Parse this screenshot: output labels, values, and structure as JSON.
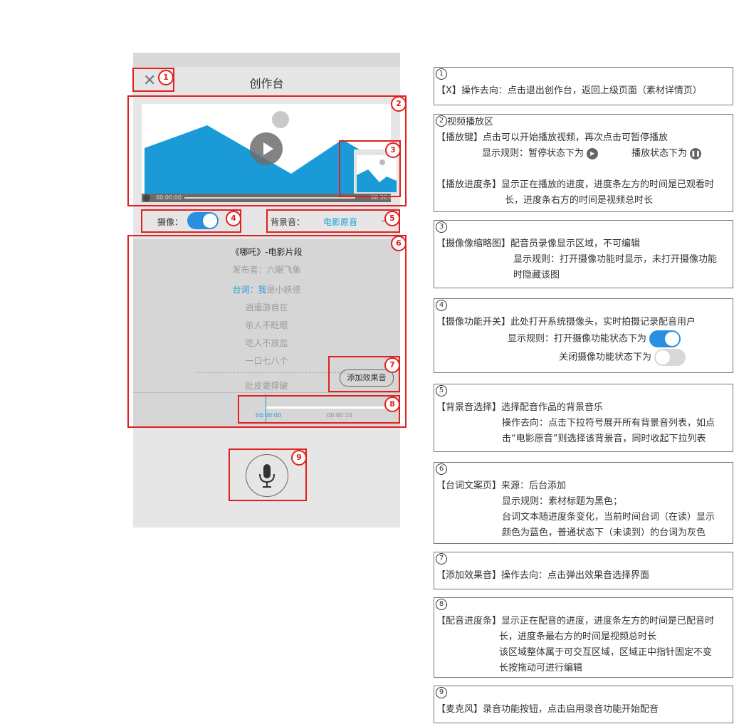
{
  "phone": {
    "title": "创作台",
    "close_glyph": "✕",
    "video": {
      "time_start": "00:00:00",
      "time_end": "00:30:00"
    },
    "camera_label": "摄像：",
    "camera_on": true,
    "bgm_label": "背景音：",
    "bgm_value": "电影原音",
    "material_title": "《哪吒》-电影片段",
    "publisher": "发布者：六眼飞鱼",
    "lyric_prefix": "台词：",
    "lyric_current_read": "我",
    "lyric_current_rest": "是小妖怪",
    "lyrics": [
      "逍遥游自在",
      "杀人不眨眼",
      "吃人不放盐",
      "一口七八个",
      "肚皮要撑破"
    ],
    "add_effect_label": "添加效果音",
    "dub_time_start": "00:00:00",
    "dub_time_end": "00:00:10",
    "mic_icon": "microphone-icon"
  },
  "badges": [
    "1",
    "2",
    "3",
    "4",
    "5",
    "6",
    "7",
    "8",
    "9"
  ],
  "colors": {
    "accent": "#1a9bd7",
    "annotation": "#e02020",
    "toggle_on": "#2a8fe0"
  },
  "notes": [
    {
      "num": "1",
      "lines": [
        "【X】操作去向：点击退出创作台，返回上级页面（素材详情页）"
      ]
    },
    {
      "num": "2",
      "heading": "视频播放区",
      "lines": [
        "【播放键】点击可以开始播放视频，再次点击可暂停播放",
        "显示规则：暂停状态下为",
        "播放状态下为",
        "【播放进度条】显示正在播放的进度，进度条左方的时间是已观看时",
        "长，进度条右方的时间是视频总时长"
      ]
    },
    {
      "num": "3",
      "lines": [
        "【摄像像缩略图】配音员录像显示区域，不可编辑",
        "显示规则：打开摄像功能时显示，未打开摄像功能",
        "时隐藏该图"
      ]
    },
    {
      "num": "4",
      "lines": [
        "【摄像功能开关】此处打开系统摄像头，实时拍摄记录配音用户",
        "显示规则：打开摄像功能状态下为",
        "关闭摄像功能状态下为"
      ]
    },
    {
      "num": "5",
      "lines": [
        "【背景音选择】选择配音作品的背景音乐",
        "操作去向：点击下拉符号展开所有背景音列表，如点",
        "击“电影原音”则选择该背景音，同时收起下拉列表"
      ]
    },
    {
      "num": "6",
      "lines": [
        "【台词文案页】来源：后台添加",
        "显示规则：素材标题为黑色；",
        "台词文本随进度条变化，当前时间台词（在读）显示",
        "颜色为蓝色，普通状态下（未读到）的台词为灰色"
      ]
    },
    {
      "num": "7",
      "lines": [
        "【添加效果音】操作去向：点击弹出效果音选择界面"
      ]
    },
    {
      "num": "8",
      "lines": [
        "【配音进度条】显示正在配音的进度，进度条左方的时间是已配音时",
        "长，进度条最右方的时间是视频总时长",
        "该区域整体属于可交互区域，区域正中指针固定不变",
        "长按拖动可进行编辑"
      ]
    },
    {
      "num": "9",
      "lines": [
        "【麦克风】录音功能按钮，点击启用录音功能开始配音"
      ]
    }
  ]
}
